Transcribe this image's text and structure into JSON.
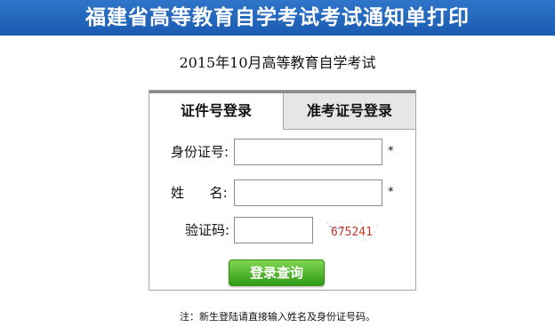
{
  "banner": {
    "title": "福建省高等教育自学考试考试通知单打印"
  },
  "exam": {
    "title": "2015年10月高等教育自学考试"
  },
  "tabs": [
    {
      "label": "证件号登录",
      "active": true
    },
    {
      "label": "准考证号登录",
      "active": false
    }
  ],
  "form": {
    "id_label": "身份证号:",
    "id_value": "",
    "name_label": "姓      名:",
    "name_value": "",
    "captcha_label": "验证码:",
    "captcha_value": "",
    "captcha_code": "675241",
    "required_mark": "*",
    "submit_label": "登录查询"
  },
  "note": "注：新生登陆请直接输入姓名及身份证号码。",
  "colors": {
    "banner": "#1f63b8",
    "submit": "#3fa81f",
    "captcha_text": "#c0392b"
  }
}
